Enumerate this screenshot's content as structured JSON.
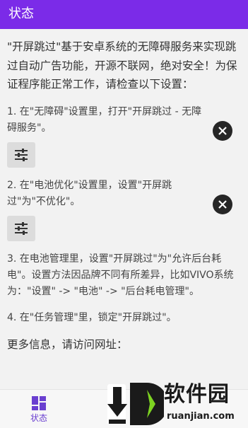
{
  "appbar": {
    "title": "状态"
  },
  "intro": "\"开屏跳过\"基于安卓系统的无障碍服务来实现跳过自动广告功能，开源不联网，绝对安全！为保证程序能正常工作，请检查以下设置：",
  "steps": [
    {
      "text": "1. 在\"无障碍\"设置里，打开\"开屏跳过 - 无障碍服务\"。",
      "settings_icon": "sliders-icon",
      "dismiss_icon": "close-icon"
    },
    {
      "text": "2. 在\"电池优化\"设置里，设置\"开屏跳过\"为\"不优化\"。",
      "settings_icon": "sliders-icon",
      "dismiss_icon": "close-icon"
    },
    {
      "text": "3. 在电池管理里，设置\"开屏跳过\"为\"允许后台耗电\"。设置方法因品牌不同有所差异，比如VIVO系统为：\"设置\" -> \"电池\" -> \"后台耗电管理\"。"
    },
    {
      "text": "4. 在\"任务管理\"里，锁定\"开屏跳过\"。"
    }
  ],
  "more_info": "更多信息，请访问网址：",
  "bottom_nav": {
    "items": [
      {
        "label": "状态",
        "icon": "dashboard-icon"
      }
    ],
    "active_color": "#6a3fd0"
  },
  "watermark": {
    "title": "软件园",
    "url": "ruanjian.com"
  },
  "colors": {
    "appbar": "#7b2be8",
    "background": "#f2f2f2",
    "accent": "#6a3fd0"
  }
}
